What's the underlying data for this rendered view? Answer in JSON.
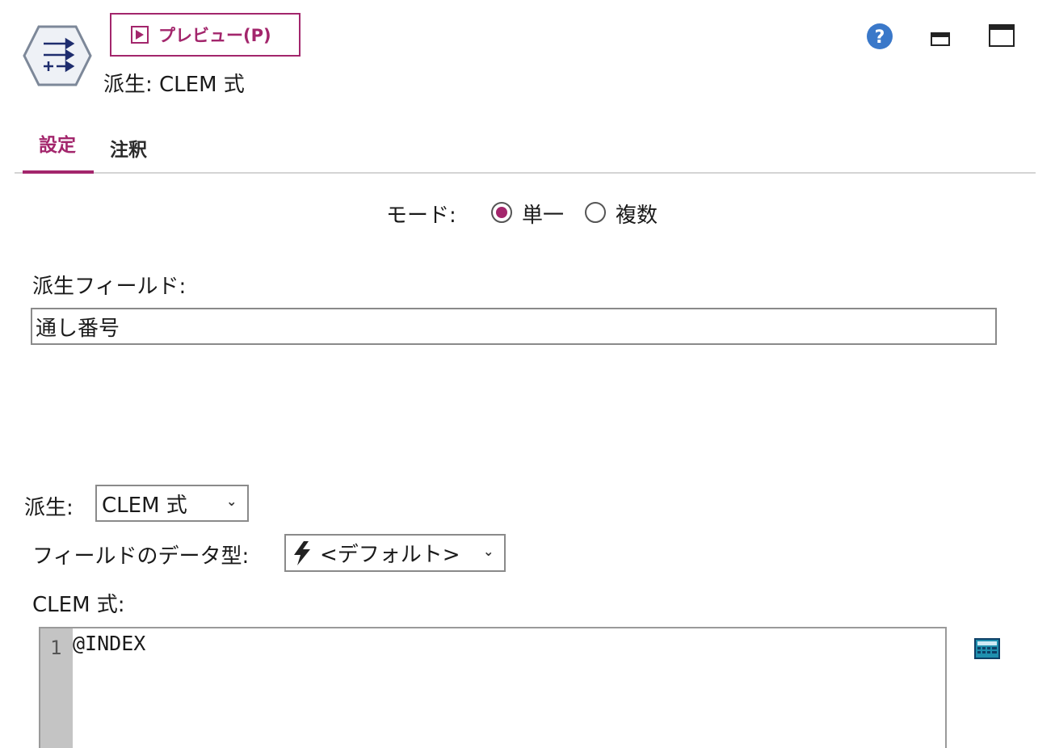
{
  "header": {
    "preview_label": "プレビュー(P)",
    "node_title": "派生: CLEM 式",
    "icons": [
      "derive-node-icon",
      "play-icon",
      "help-icon",
      "minimize-icon",
      "maximize-icon"
    ]
  },
  "tabs": [
    {
      "label": "設定",
      "active": true
    },
    {
      "label": "注釈",
      "active": false
    }
  ],
  "mode": {
    "label": "モード:",
    "options": [
      {
        "label": "単一",
        "selected": true
      },
      {
        "label": "複数",
        "selected": false
      }
    ]
  },
  "derive_field": {
    "label": "派生フィールド:",
    "value": "通し番号"
  },
  "derive_as": {
    "label": "派生:",
    "selected": "CLEM 式"
  },
  "field_type": {
    "label": "フィールドのデータ型:",
    "selected": "<デフォルト>"
  },
  "clem": {
    "label": "CLEM 式:",
    "line_number": "1",
    "code": "@INDEX"
  },
  "colors": {
    "accent": "#a3266c",
    "help_blue": "#3a78c9"
  }
}
